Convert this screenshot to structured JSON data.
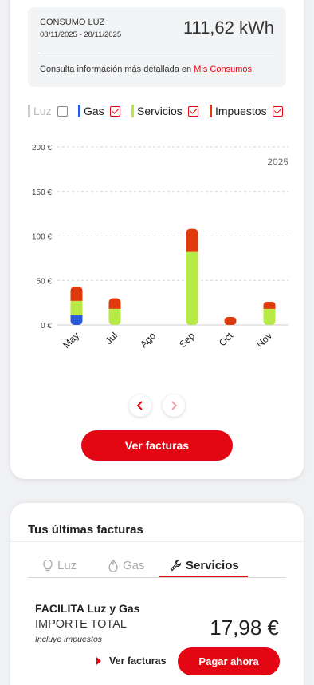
{
  "summary": {
    "label": "CONSUMO LUZ",
    "date_range": "08/11/2025 - 28/11/2025",
    "value": "111,62 kWh",
    "more_text": "Consulta información más detallada en ",
    "more_link": "Mis Consumos"
  },
  "legend": [
    {
      "label": "Luz",
      "color": "#d0d0d0",
      "checked": false,
      "disabled": true
    },
    {
      "label": "Gas",
      "color": "#2b59e0",
      "checked": true,
      "disabled": false
    },
    {
      "label": "Servicios",
      "color": "#b7ea45",
      "checked": true,
      "disabled": false
    },
    {
      "label": "Impuestos",
      "color": "#e03a0c",
      "checked": true,
      "disabled": false
    }
  ],
  "chart_data": {
    "type": "bar",
    "stacked": true,
    "year_label": "2025",
    "categories": [
      "May",
      "Jul",
      "Ago",
      "Sep",
      "Oct",
      "Nov"
    ],
    "y_tick_labels": [
      "200 €",
      "150 €",
      "100 €",
      "50 €",
      "0 €"
    ],
    "y_ticks": [
      200,
      150,
      100,
      50,
      0
    ],
    "ylim": [
      0,
      200
    ],
    "grid": true,
    "series": [
      {
        "name": "Gas",
        "color": "#2b59e0",
        "values": [
          11,
          0,
          0,
          0,
          0,
          0
        ]
      },
      {
        "name": "Servicios",
        "color": "#b7ea45",
        "values": [
          16,
          18,
          0,
          82,
          0,
          18
        ]
      },
      {
        "name": "Impuestos",
        "color": "#e03a0c",
        "values": [
          16,
          12,
          0,
          26,
          9,
          8
        ]
      }
    ]
  },
  "pager": {
    "prev": "‹",
    "next": "›"
  },
  "buttons": {
    "ver_facturas": "Ver facturas"
  },
  "invoices": {
    "title": "Tus últimas facturas",
    "tabs": [
      {
        "label": "Luz",
        "icon": "lightbulb-icon",
        "active": false
      },
      {
        "label": "Gas",
        "icon": "flame-icon",
        "active": false
      },
      {
        "label": "Servicios",
        "icon": "wrench-icon",
        "active": true
      }
    ],
    "item": {
      "name": "FACILITA Luz y Gas",
      "total_label": "IMPORTE TOTAL",
      "tax_note": "Incluye impuestos",
      "amount": "17,98 €",
      "ver_label": "Ver facturas",
      "pay_label": "Pagar ahora"
    }
  }
}
